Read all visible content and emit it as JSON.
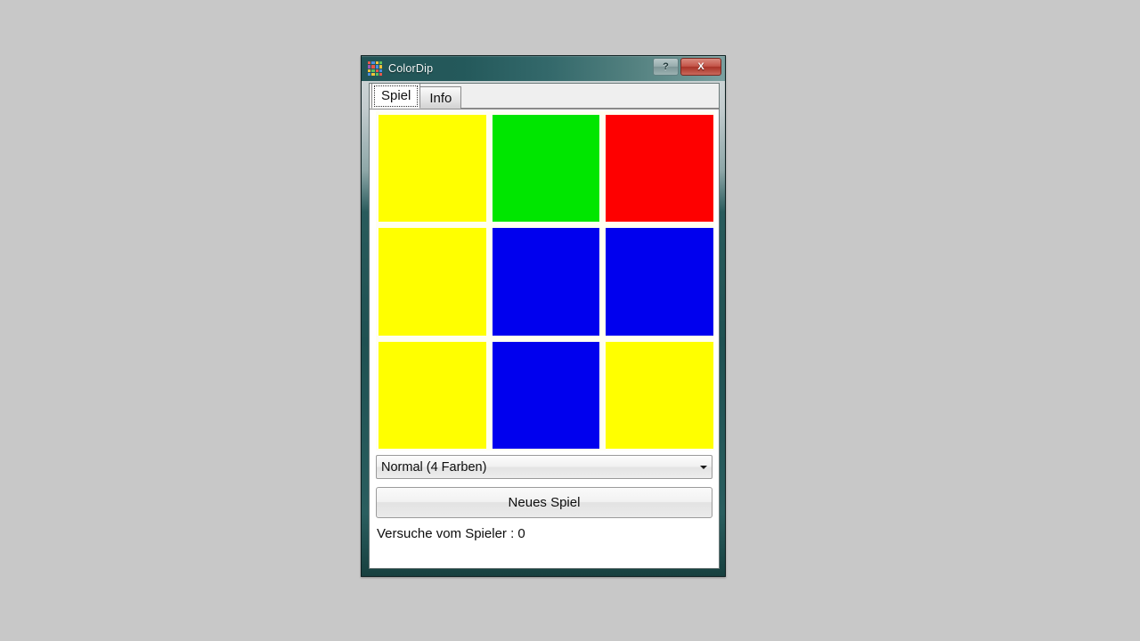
{
  "window": {
    "title": "ColorDip",
    "icon_name": "colordip-grid-icon",
    "icon_colors": [
      "#e8574a",
      "#4a8fe0",
      "#f0c23a",
      "#5fbf5f",
      "#9b59b6",
      "#e8574a",
      "#4a8fe0",
      "#f0c23a",
      "#f0c23a",
      "#5fbf5f",
      "#e8574a",
      "#4a8fe0",
      "#4a8fe0",
      "#f0c23a",
      "#5fbf5f",
      "#e8574a"
    ],
    "buttons": {
      "help_label": "?",
      "close_label": "X"
    }
  },
  "tabs": [
    {
      "label": "Spiel",
      "active": true
    },
    {
      "label": "Info",
      "active": false
    }
  ],
  "board": {
    "background_color": "#fffff0",
    "rows": 3,
    "cols": 3,
    "tiles": [
      {
        "color": "#ffff00",
        "name": "yellow"
      },
      {
        "color": "#00e600",
        "name": "green"
      },
      {
        "color": "#fe0000",
        "name": "red"
      },
      {
        "color": "#ffff00",
        "name": "yellow"
      },
      {
        "color": "#0000ee",
        "name": "blue"
      },
      {
        "color": "#0000ee",
        "name": "blue"
      },
      {
        "color": "#ffff00",
        "name": "yellow"
      },
      {
        "color": "#0000ee",
        "name": "blue"
      },
      {
        "color": "#ffff00",
        "name": "yellow"
      }
    ]
  },
  "controls": {
    "difficulty_value": "Normal (4 Farben)",
    "difficulty_options": [
      "Normal (4 Farben)"
    ],
    "new_game_label": "Neues Spiel",
    "status_text": "Versuche vom Spieler : 0"
  }
}
